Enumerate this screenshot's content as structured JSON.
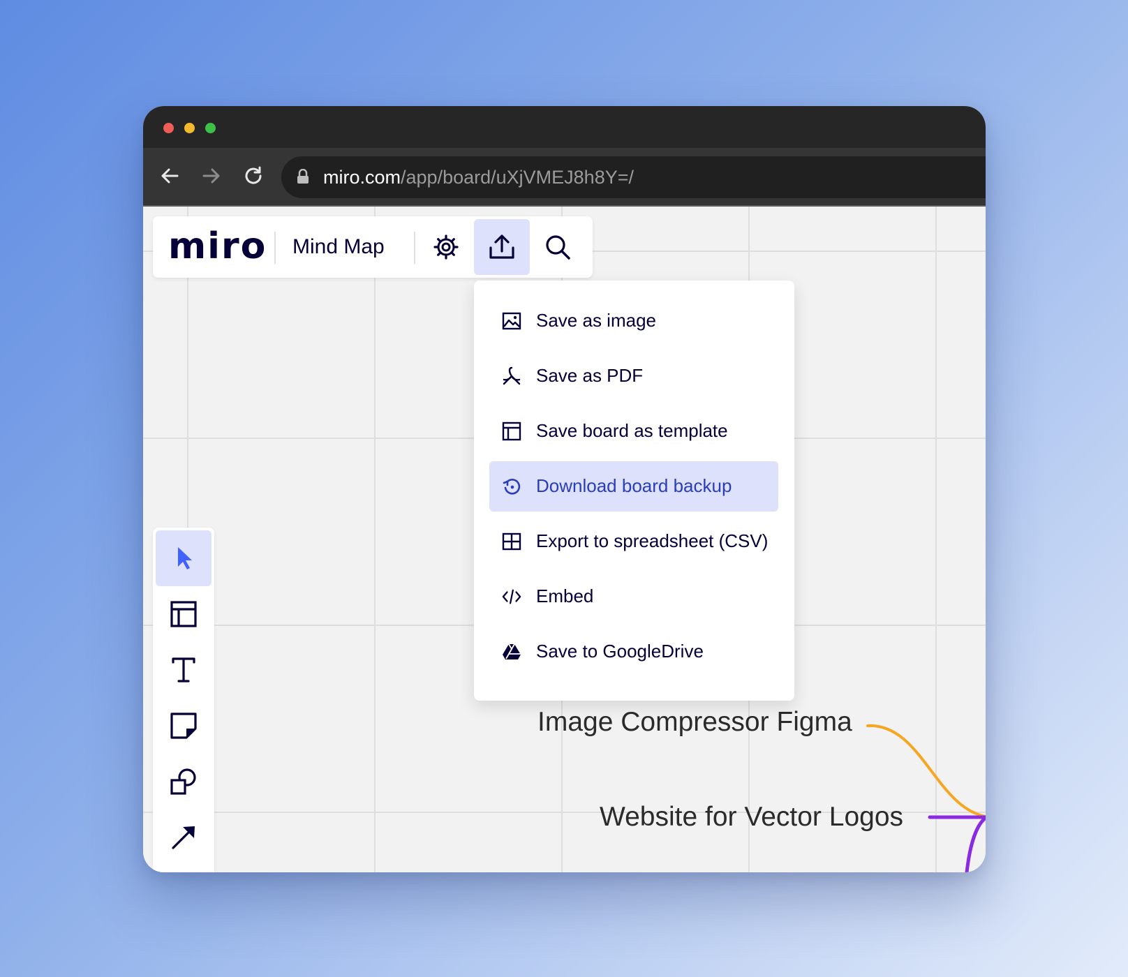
{
  "browser": {
    "url_host": "miro.com",
    "url_path": "/app/board/uXjVMEJ8h8Y=/"
  },
  "app": {
    "logo": "miro",
    "board_name": "Mind Map"
  },
  "toolbar_icons": [
    "gear-icon",
    "upload-icon",
    "search-icon"
  ],
  "export_menu": {
    "items": [
      {
        "label": "Save as image",
        "icon": "image-icon"
      },
      {
        "label": "Save as PDF",
        "icon": "pdf-icon"
      },
      {
        "label": "Save board as template",
        "icon": "template-icon"
      },
      {
        "label": "Download board backup",
        "icon": "backup-icon",
        "highlighted": true
      },
      {
        "label": "Export to spreadsheet (CSV)",
        "icon": "spreadsheet-icon"
      },
      {
        "label": "Embed",
        "icon": "code-icon"
      },
      {
        "label": "Save to GoogleDrive",
        "icon": "google-drive-icon"
      }
    ]
  },
  "tools": [
    "select-tool",
    "frame-tool",
    "text-tool",
    "sticky-note-tool",
    "shapes-tool",
    "arrow-tool"
  ],
  "canvas": {
    "nodes": [
      {
        "text": "Image Compressor Figma",
        "connector_color": "#f5a623"
      },
      {
        "text": "Website for Vector Logos",
        "connector_color": "#8a2be2"
      }
    ]
  },
  "colors": {
    "accent": "#4262ff",
    "highlight_bg": "#dde1fb",
    "ink": "#050038"
  }
}
